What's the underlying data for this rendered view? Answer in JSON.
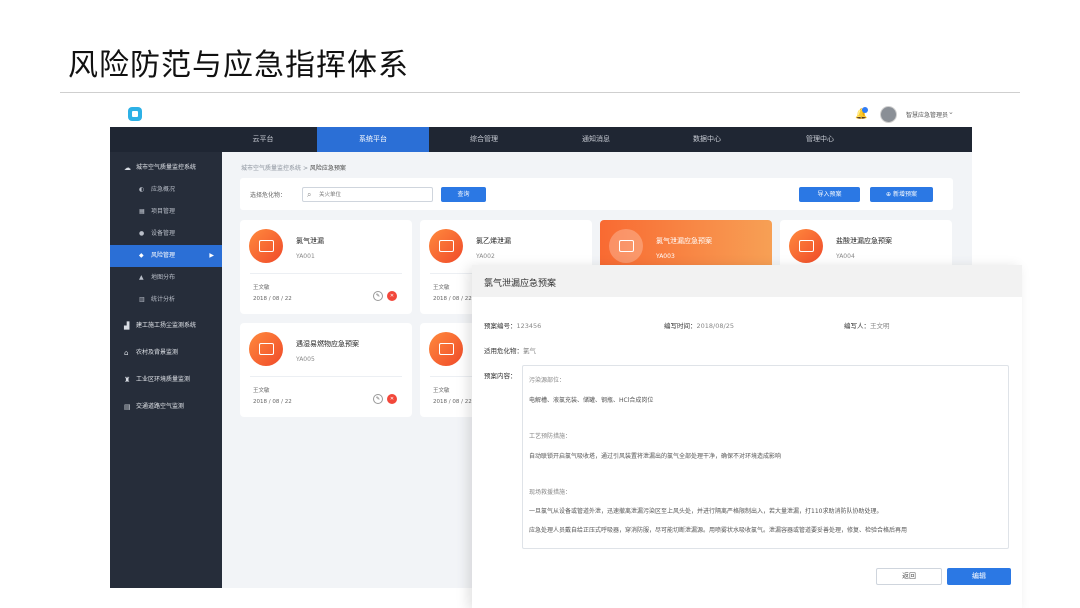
{
  "slide": {
    "title": "风险防范与应急指挥体系"
  },
  "topbar": {
    "user_name": "智慧应急管理员",
    "chevron": "⌄",
    "bell_icon": "bell-icon"
  },
  "nav": [
    "云平台",
    "系统平台",
    "综合管理",
    "通知消息",
    "数据中心",
    "管理中心"
  ],
  "sidebar": {
    "group_main": "城市空气质量监控系统",
    "items": [
      "应急概况",
      "项目管理",
      "设备管理",
      "风险管理",
      "地图分布",
      "统计分析"
    ],
    "groups": [
      "建工施工扬尘监测系统",
      "农村及背景监测",
      "工业区环境质量监测",
      "交通道路空气监测"
    ]
  },
  "breadcrumb": {
    "parent": "城市空气质量监控系统",
    "sep": ">",
    "current": "风险应急预案"
  },
  "filter": {
    "label": "选择危化物：",
    "placeholder": "关火单位",
    "query_btn": "查询",
    "import_btn": "导入预案",
    "add_btn": "新增预案",
    "add_icon": "⊕"
  },
  "cards": [
    {
      "title": "氯气泄漏",
      "code": "YA001",
      "author": "王文敏",
      "date": "2018 / 08 / 22"
    },
    {
      "title": "氯乙烯泄漏",
      "code": "YA002",
      "author": "王文敏",
      "date": "2018 / 08 / 22"
    },
    {
      "title": "氯气泄漏应急预案",
      "code": "YA003"
    },
    {
      "title": "盐酸泄漏应急预案",
      "code": "YA004"
    },
    {
      "title": "遇湿易燃物应急预案",
      "code": "YA005",
      "author": "王文敏",
      "date": "2018 / 08 / 22"
    },
    {
      "author": "王文敏",
      "date": "2018 / 08 / 22"
    }
  ],
  "panel": {
    "title": "氯气泄漏应急预案",
    "code_label": "预案编号：",
    "code_value": "123456",
    "time_label": "编写时间：",
    "time_value": "2018/08/25",
    "writer_label": "编写人：",
    "writer_value": "王文明",
    "chem_label": "适用危化物：",
    "chem_value": "氯气",
    "content_label": "预案内容：",
    "sections": [
      {
        "head": "污染源部位：",
        "text": [
          "电解槽、液氯充装、储罐、钢瓶、HCl合成岗位"
        ]
      },
      {
        "head": "工艺预防措施：",
        "text": [
          "自动联锁开启氯气吸收塔，通过引风装置将泄漏出的氯气全部处理干净，确保不对环境造成影响"
        ]
      },
      {
        "head": "现场救援措施：",
        "text": [
          "一旦氯气从设备或管道外泄，迅速撤离泄漏污染区至上风头处，并进行隔离严格限制出入，若大量泄漏，打110求助消防队协助处理。",
          "应急处理人员戴自给正压式呼吸器，穿消防服，尽可能切断泄漏源。用喷雾状水吸收氯气。泄漏容器或管道要妥善处理，修复、检验合格后再用"
        ]
      }
    ],
    "back_btn": "返回",
    "edit_btn": "编辑"
  }
}
